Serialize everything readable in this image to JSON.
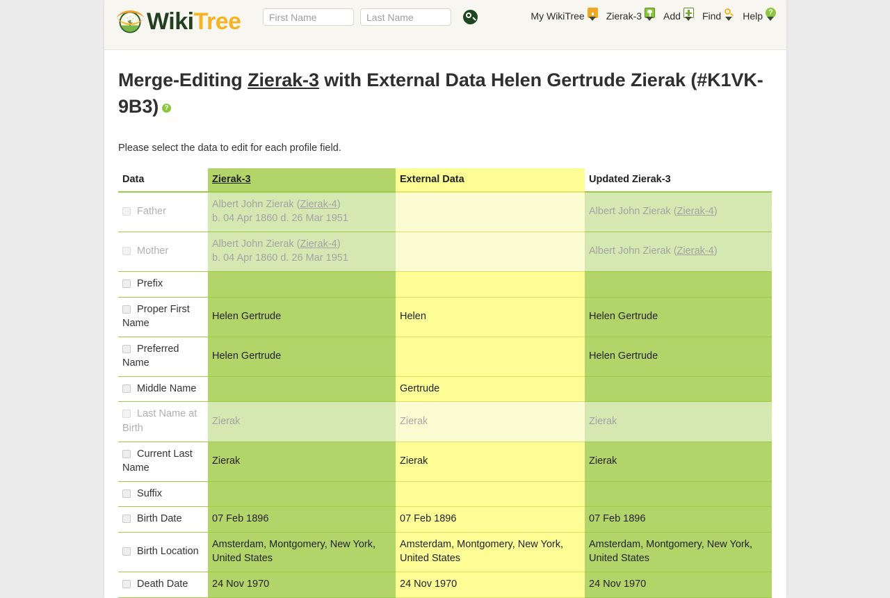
{
  "header": {
    "logo": {
      "wiki": "Wiki",
      "tree": "Tree",
      "alt": "wikitree-logo"
    },
    "search": {
      "first_name_placeholder": "First Name",
      "first_name_value": "",
      "last_name_placeholder": "Last Name",
      "last_name_value": "",
      "search_icon": "search-icon"
    },
    "nav": [
      {
        "label": "My WikiTree",
        "icon": "home-icon"
      },
      {
        "label": "Zierak-3",
        "icon": "tree-icon"
      },
      {
        "label": "Add",
        "icon": "plus-icon"
      },
      {
        "label": "Find",
        "icon": "magnifier-icon"
      },
      {
        "label": "Help",
        "icon": "question-icon"
      }
    ]
  },
  "main": {
    "title_part1": "Merge-Editing ",
    "title_link": "Zierak-3",
    "title_part2": " with External Data Helen Gertrude Zierak (#K1VK-9B3)",
    "title_help_icon": "?",
    "intro": "Please select the data to edit for each profile field.",
    "table": {
      "columns": [
        "Data",
        "Zierak-3",
        "External Data",
        "Updated Zierak-3"
      ],
      "rows": [
        {
          "label": "Father",
          "disabled": true,
          "a_name": "Albert John Zierak (",
          "a_link": "Zierak-4",
          "a_close": ")",
          "a_dates": "b. 04 Apr 1860 d. 26 Mar 1951",
          "b": "",
          "c_name": "Albert John Zierak (",
          "c_link": "Zierak-4",
          "c_close": ")"
        },
        {
          "label": "Mother",
          "disabled": true,
          "a_name": "Albert John Zierak (",
          "a_link": "Zierak-4",
          "a_close": ")",
          "a_dates": "b. 04 Apr 1860 d. 26 Mar 1951",
          "b": "",
          "c_name": "Albert John Zierak (",
          "c_link": "Zierak-4",
          "c_close": ")"
        },
        {
          "label": "Prefix",
          "disabled": false,
          "a": "",
          "b": "",
          "c": ""
        },
        {
          "label": "Proper First Name",
          "disabled": false,
          "a": "Helen Gertrude",
          "b": "Helen",
          "c": "Helen Gertrude"
        },
        {
          "label": "Preferred Name",
          "disabled": false,
          "a": "Helen Gertrude",
          "b": "",
          "c": "Helen Gertrude"
        },
        {
          "label": "Middle Name",
          "disabled": false,
          "a": "",
          "b": "Gertrude",
          "c": ""
        },
        {
          "label": "Last Name at Birth",
          "disabled": true,
          "a": "Zierak",
          "b": "Zierak",
          "c": "Zierak"
        },
        {
          "label": "Current Last Name",
          "disabled": false,
          "a": "Zierak",
          "b": "Zierak",
          "c": "Zierak"
        },
        {
          "label": "Suffix",
          "disabled": false,
          "a": "",
          "b": "",
          "c": ""
        },
        {
          "label": "Birth Date",
          "disabled": false,
          "a": "07 Feb 1896",
          "b": "07 Feb 1896",
          "c": "07 Feb 1896"
        },
        {
          "label": "Birth Location",
          "disabled": false,
          "a": "Amsterdam, Montgomery, New York, United States",
          "b": "Amsterdam, Montgomery, New York, United States",
          "c": "Amsterdam, Montgomery, New York, United States"
        },
        {
          "label": "Death Date",
          "disabled": false,
          "a": "24 Nov 1970",
          "b": "24 Nov 1970",
          "c": "24 Nov 1970"
        }
      ]
    }
  },
  "colors": {
    "green_cell": "#b3d468",
    "yellow_cell": "#fdfd96",
    "green_faded": "#d5e8b2",
    "yellow_faded": "#fcfcd3",
    "green_border": "#9acd44",
    "brand_green": "#22401f",
    "brand_gold": "#f5b325"
  }
}
